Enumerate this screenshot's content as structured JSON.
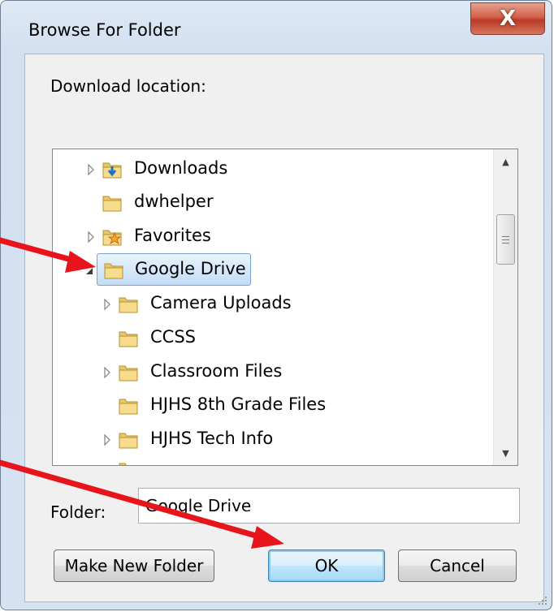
{
  "window": {
    "title": "Browse For Folder",
    "close_label": "X"
  },
  "dialog": {
    "instruction": "Download location:",
    "folder_label": "Folder:",
    "folder_value": "Google Drive",
    "buttons": {
      "make_new_folder": "Make New Folder",
      "ok": "OK",
      "cancel": "Cancel"
    }
  },
  "tree": {
    "items": [
      {
        "label": "Downloads",
        "icon": "downloads-folder-icon",
        "expander": "collapsed",
        "selected": false
      },
      {
        "label": "dwhelper",
        "icon": "folder-icon",
        "expander": "none",
        "selected": false
      },
      {
        "label": "Favorites",
        "icon": "favorites-folder-icon",
        "expander": "collapsed",
        "selected": false
      },
      {
        "label": "Google Drive",
        "icon": "folder-icon",
        "expander": "expanded",
        "selected": true
      },
      {
        "label": "Camera Uploads",
        "icon": "folder-icon",
        "expander": "collapsed",
        "selected": false
      },
      {
        "label": "CCSS",
        "icon": "folder-icon",
        "expander": "none",
        "selected": false
      },
      {
        "label": "Classroom Files",
        "icon": "folder-icon",
        "expander": "collapsed",
        "selected": false
      },
      {
        "label": "HJHS 8th Grade Files",
        "icon": "folder-icon",
        "expander": "none",
        "selected": false
      },
      {
        "label": "HJHS Tech Info",
        "icon": "folder-icon",
        "expander": "collapsed",
        "selected": false
      }
    ]
  },
  "colors": {
    "annotation_arrow": "#e8141b",
    "selection_border": "#7da2ce",
    "close_button": "#c8452f"
  }
}
